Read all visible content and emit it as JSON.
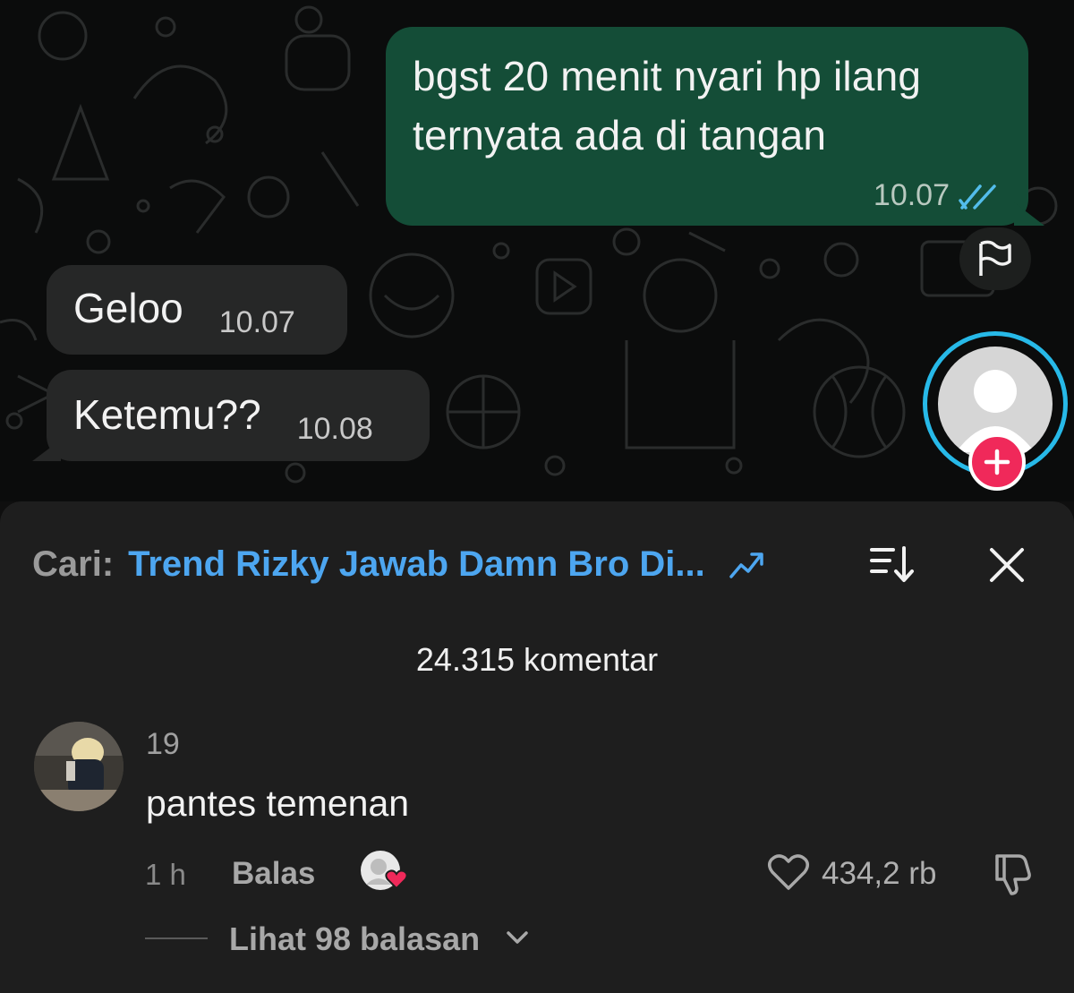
{
  "chat": {
    "outgoing": {
      "text": "bgst 20 menit nyari hp ilang ternyata ada di tangan",
      "time": "10.07",
      "status_icon": "double-check-icon"
    },
    "incoming": [
      {
        "text": "Geloo",
        "time": "10.07"
      },
      {
        "text": "Ketemu??",
        "time": "10.08"
      }
    ],
    "side_icons": [
      "flag-icon",
      "profile-avatar",
      "plus-icon"
    ],
    "colors": {
      "outgoing_bubble": "#144d37",
      "incoming_bubble": "#262727",
      "ring": "#27b9e8",
      "follow": "#f0295a"
    }
  },
  "sheet": {
    "search_label": "Cari:",
    "search_query": "Trend Rizky Jawab Damn Bro Di...",
    "comment_count": "24.315 komentar",
    "colors": {
      "accent": "#4da6f0"
    }
  },
  "comment": {
    "username": "19",
    "text": "pantes temenan",
    "time": "1 h",
    "reply_label": "Balas",
    "likes": "434,2 rb",
    "view_replies": "Lihat 98 balasan"
  }
}
